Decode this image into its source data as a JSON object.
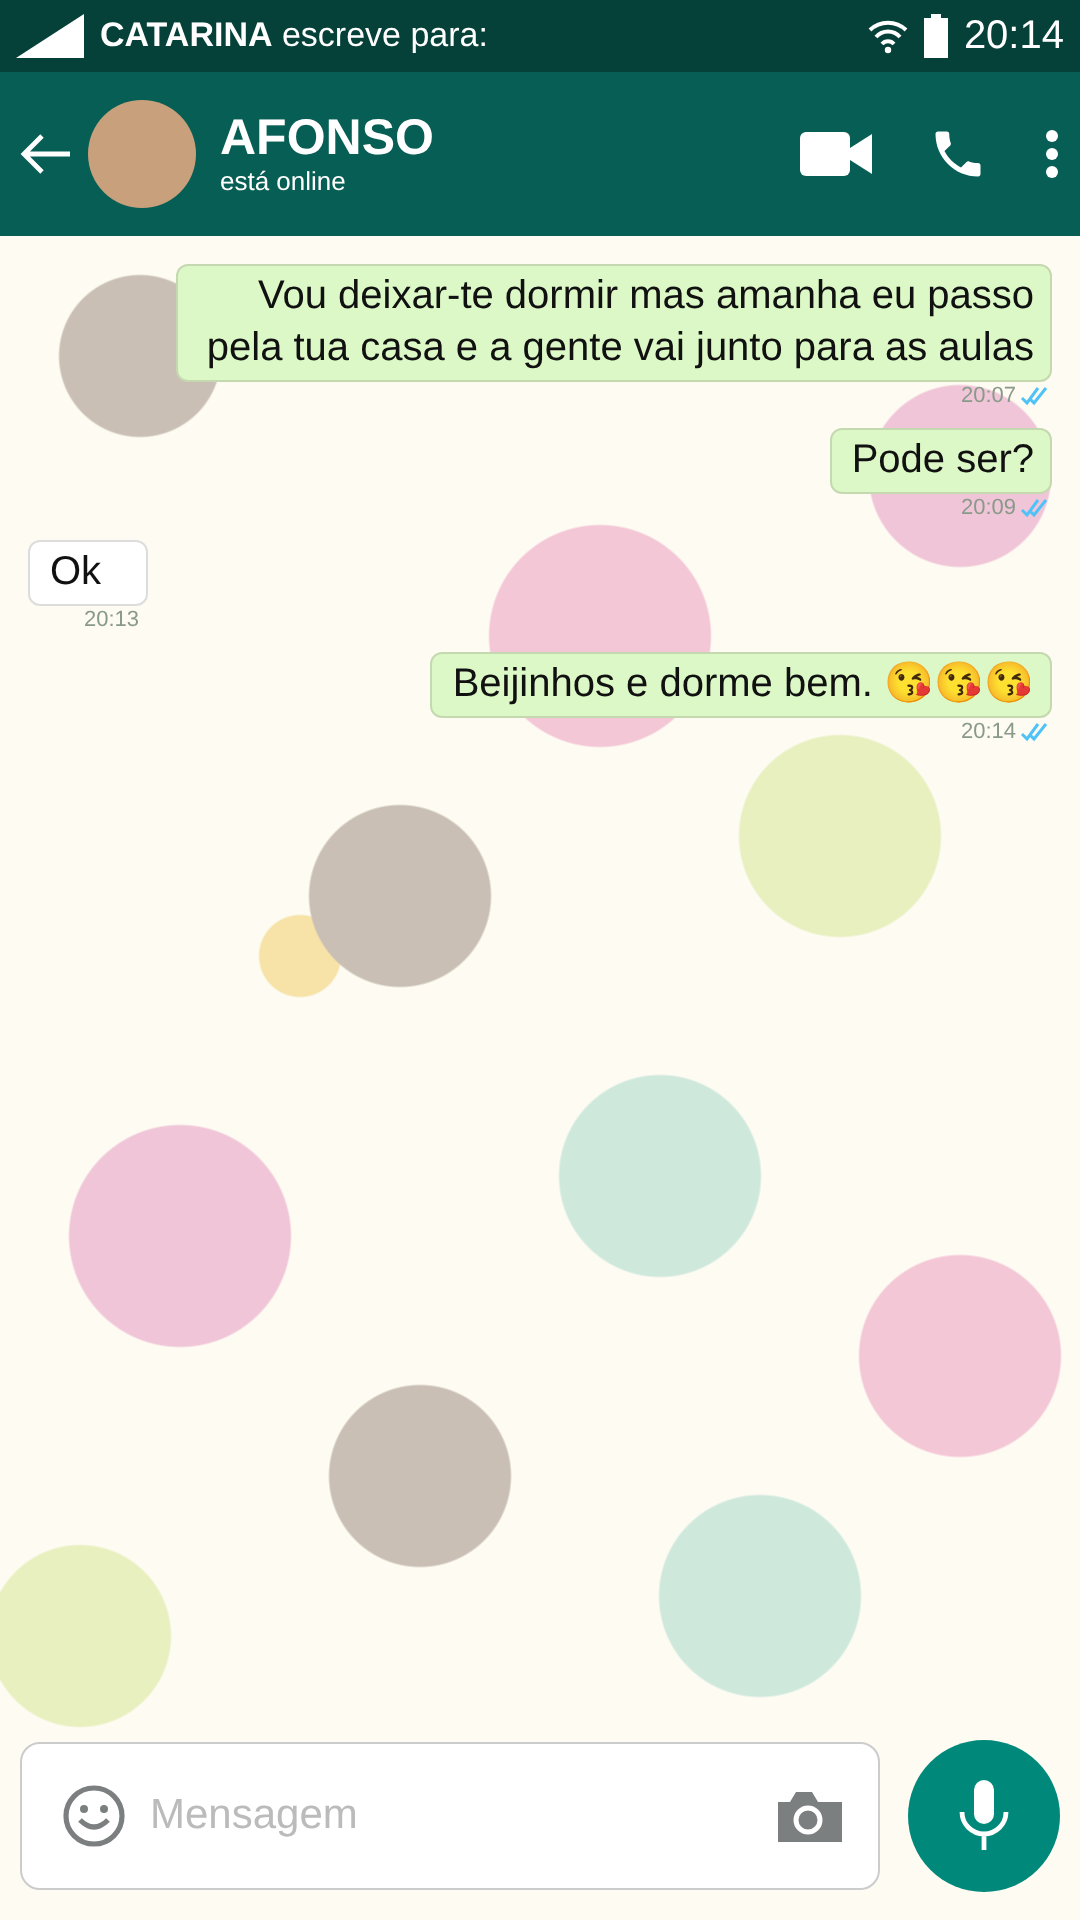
{
  "status_bar": {
    "notification": "**CATARINA** escreve para:",
    "time": "20:14"
  },
  "header": {
    "name": "AFONSO",
    "status": "está online"
  },
  "messages": [
    {
      "kind": "sent",
      "text": "Vou deixar-te dormir mas amanha eu passo pela tua casa e a gente vai junto para as aulas",
      "time": "20:07",
      "read": true
    },
    {
      "kind": "sent",
      "text": "Pode ser?",
      "time": "20:09",
      "read": true
    },
    {
      "kind": "received",
      "text": "Ok",
      "time": "20:13"
    },
    {
      "kind": "sent",
      "text": "Beijinhos e dorme bem. 😘😘😘",
      "time": "20:14",
      "read": true
    }
  ],
  "composer": {
    "placeholder": "Mensagem"
  }
}
